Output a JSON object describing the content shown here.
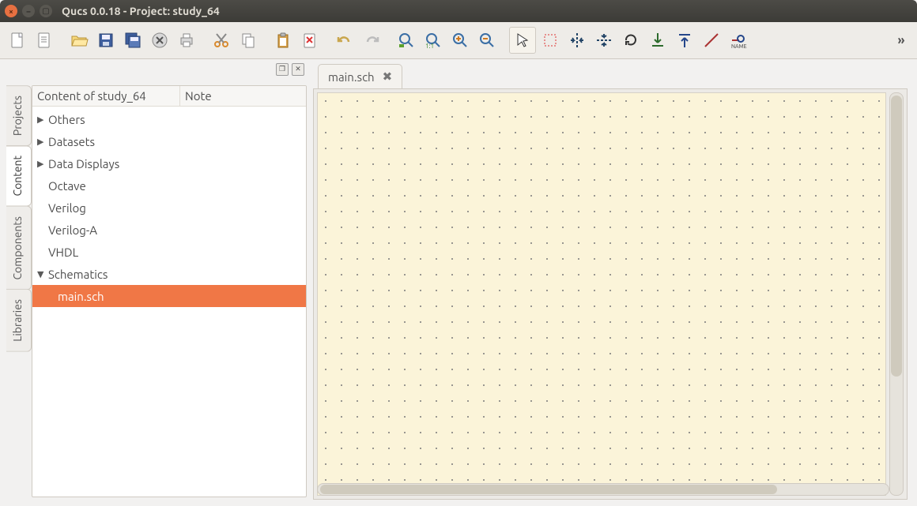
{
  "window": {
    "title": "Qucs 0.0.18 - Project: study_64"
  },
  "toolbar": {
    "overflow_glyph": "»"
  },
  "panel_controls": {
    "restore_glyph": "❐",
    "close_glyph": "✕"
  },
  "side_tabs": [
    "Projects",
    "Content",
    "Components",
    "Libraries"
  ],
  "side_tab_active": "Content",
  "content_panel": {
    "header_main": "Content of study_64",
    "header_note": "Note",
    "items": [
      {
        "label": "Others",
        "expandable": true,
        "expanded": false
      },
      {
        "label": "Datasets",
        "expandable": true,
        "expanded": false
      },
      {
        "label": "Data Displays",
        "expandable": true,
        "expanded": false
      },
      {
        "label": "Octave",
        "expandable": false
      },
      {
        "label": "Verilog",
        "expandable": false
      },
      {
        "label": "Verilog-A",
        "expandable": false
      },
      {
        "label": "VHDL",
        "expandable": false
      },
      {
        "label": "Schematics",
        "expandable": true,
        "expanded": true,
        "children": [
          {
            "label": "main.sch",
            "selected": true
          }
        ]
      }
    ]
  },
  "open_tabs": [
    {
      "label": "main.sch",
      "active": true
    }
  ]
}
